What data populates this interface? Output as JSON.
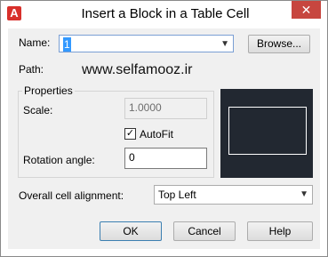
{
  "window": {
    "title": "Insert a Block in a Table Cell",
    "close_glyph": "✕",
    "app_icon": "A"
  },
  "name": {
    "label": "Name:",
    "value": "1",
    "browse_label": "Browse..."
  },
  "path": {
    "label": "Path:",
    "value": "www.selfamooz.ir"
  },
  "properties": {
    "group_label": "Properties",
    "scale_label": "Scale:",
    "scale_value": "1.0000",
    "autofit_label": "AutoFit",
    "autofit_checked": true,
    "rotation_label": "Rotation angle:",
    "rotation_value": "0"
  },
  "alignment": {
    "label": "Overall cell alignment:",
    "value": "Top Left"
  },
  "buttons": {
    "ok": "OK",
    "cancel": "Cancel",
    "help": "Help"
  },
  "colors": {
    "preview_bg": "#222831",
    "close_bg": "#c7463f",
    "accent": "#3399ff"
  }
}
